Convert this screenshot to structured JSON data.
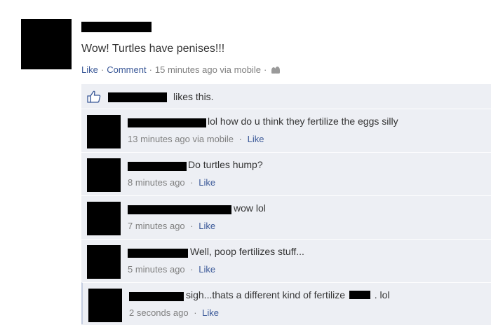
{
  "post": {
    "message": "Wow! Turtles have penises!!!",
    "actions": {
      "like": "Like",
      "comment": "Comment",
      "time": "15 minutes ago via mobile",
      "audience_icon": "friends-icon"
    }
  },
  "likes": {
    "icon": "thumbs-up-icon",
    "text": "likes this."
  },
  "comments": [
    {
      "text": "lol how do u think they fertilize the eggs silly",
      "time": "13 minutes ago via mobile",
      "like": "Like"
    },
    {
      "text": "Do turtles hump?",
      "time": "8 minutes ago",
      "like": "Like"
    },
    {
      "text": "wow lol",
      "time": "7 minutes ago",
      "like": "Like"
    },
    {
      "text": "Well, poop fertilizes stuff...",
      "time": "5 minutes ago",
      "like": "Like"
    },
    {
      "text_before": "sigh...thats a different kind of fertilize",
      "text_after": ". lol",
      "time": "2 seconds ago",
      "like": "Like"
    }
  ],
  "meta_separator": "·",
  "colors": {
    "link": "#3b5998",
    "feedback_bg": "#edeff4",
    "meta": "#808080",
    "redaction": "#000000"
  }
}
